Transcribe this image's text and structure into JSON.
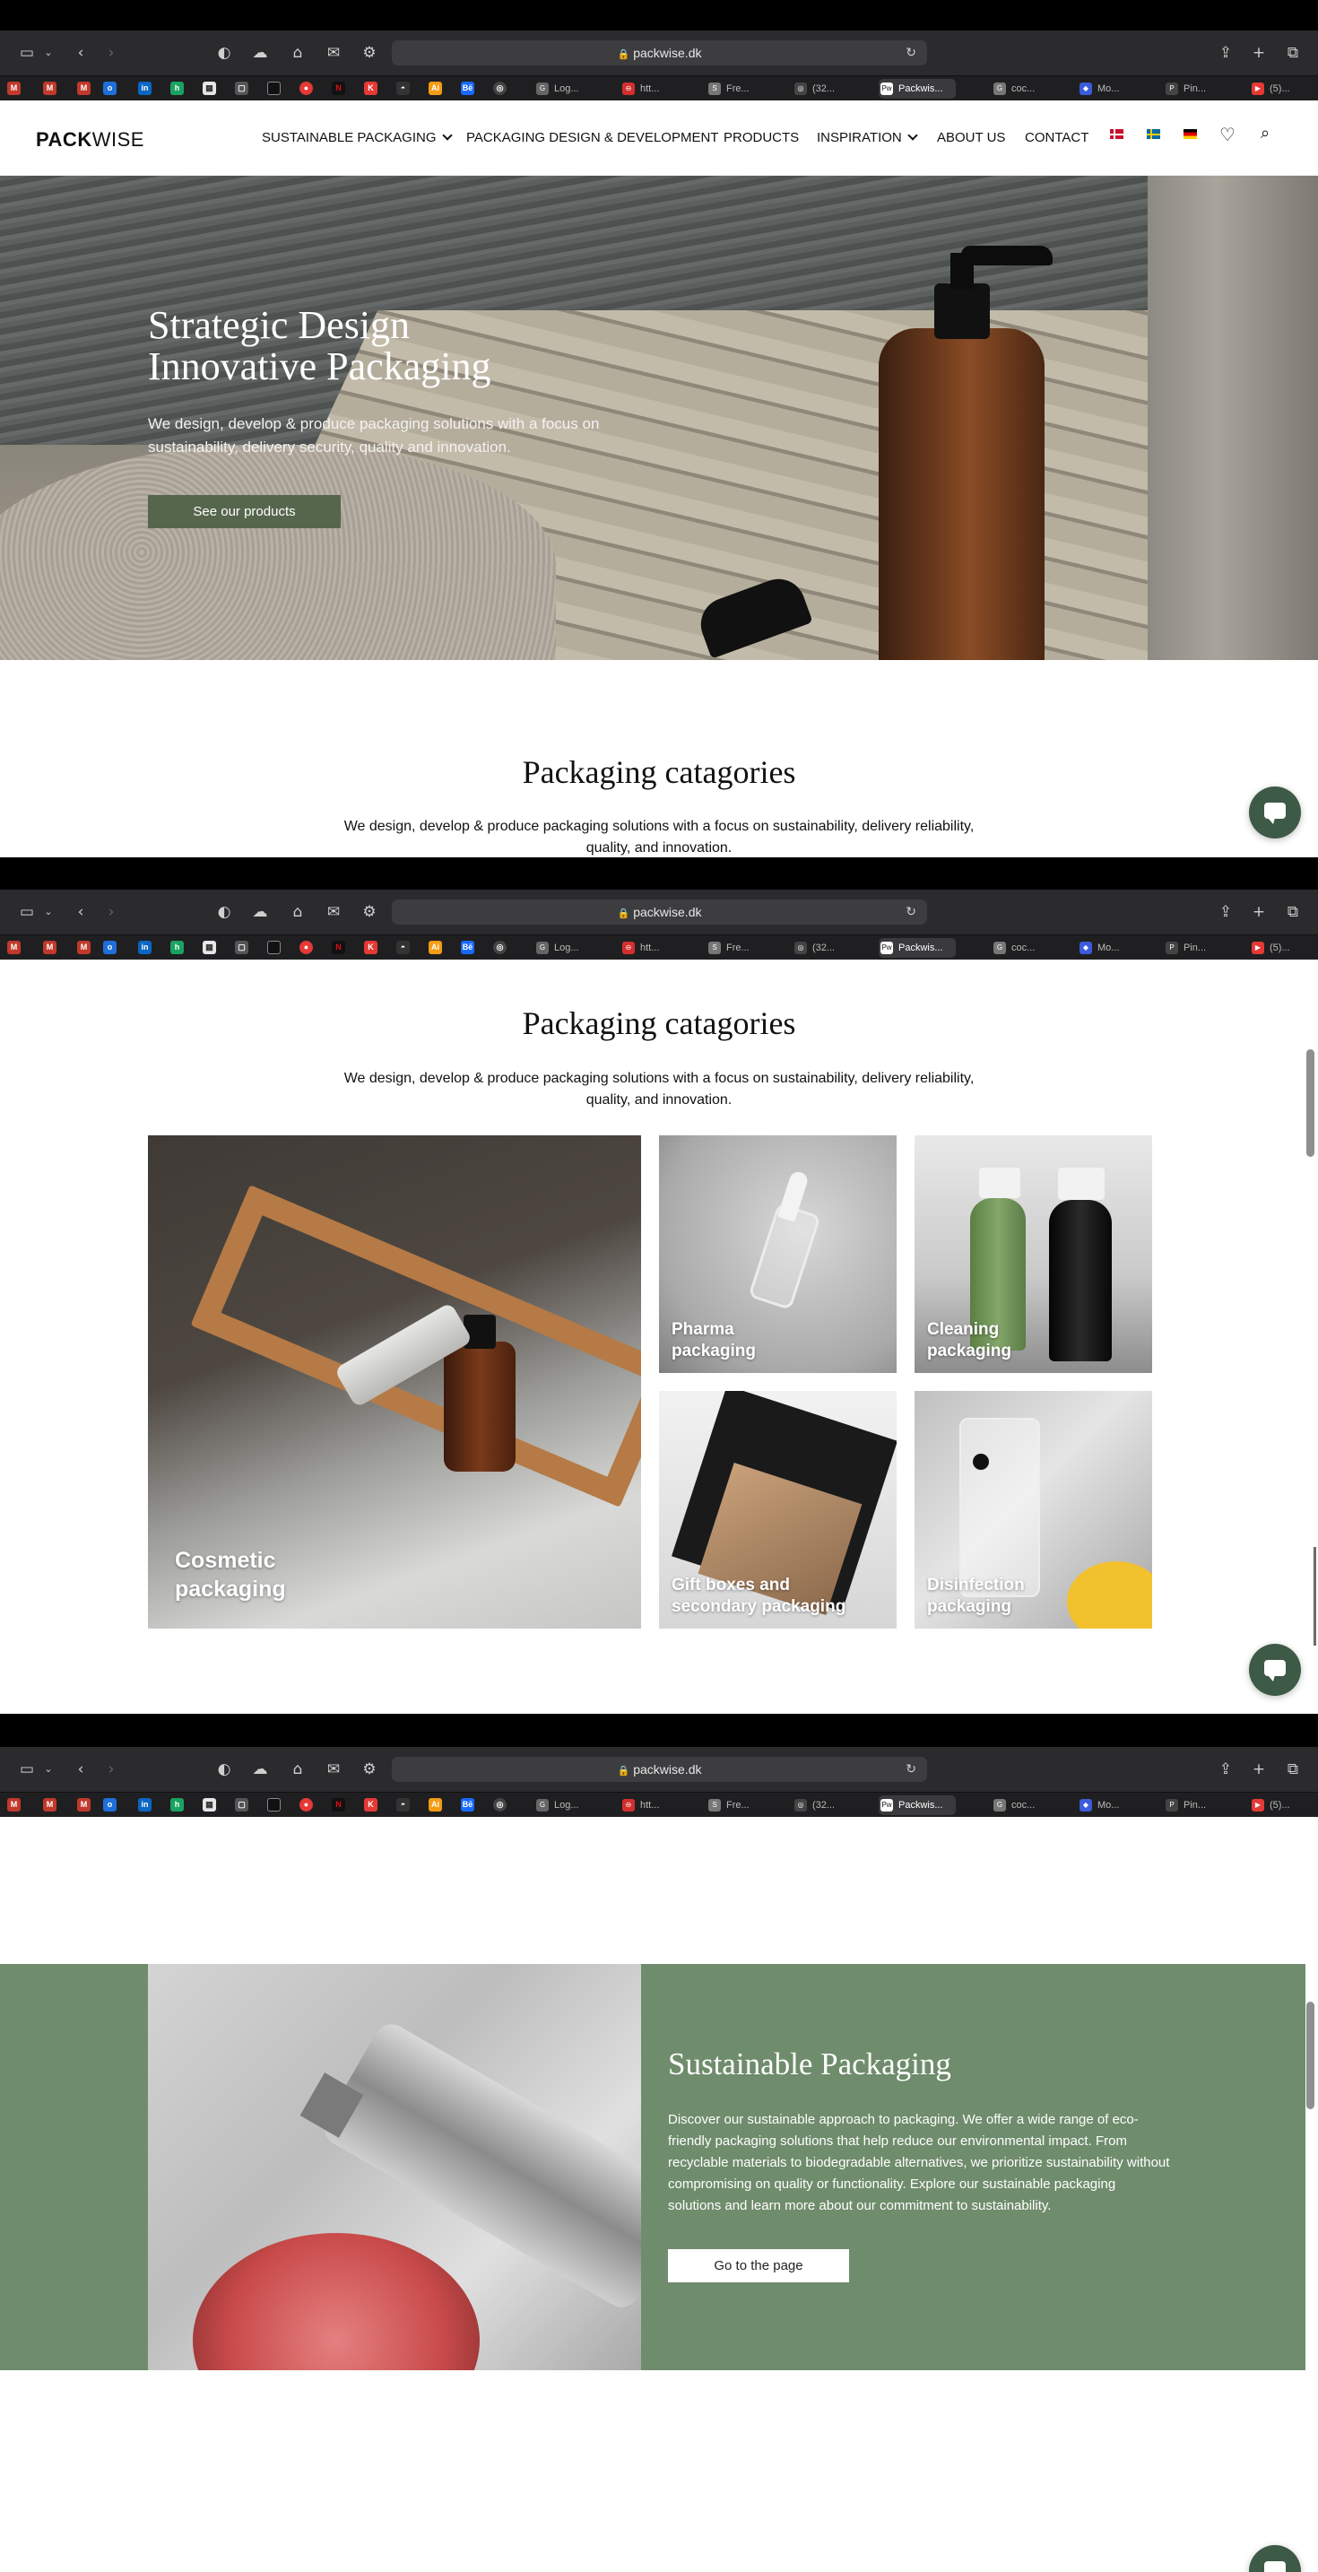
{
  "browser": {
    "url": "packwise.dk",
    "tabs": [
      {
        "label": "Log..."
      },
      {
        "label": "htt..."
      },
      {
        "label": "Fre..."
      },
      {
        "label": "(32..."
      },
      {
        "label": "Packwis..."
      },
      {
        "label": "coc..."
      },
      {
        "label": "Mo..."
      },
      {
        "label": "Pin..."
      },
      {
        "label": "(5)..."
      }
    ]
  },
  "nav": {
    "logo_bold": "PACK",
    "logo_light": "WISE",
    "items": [
      {
        "label": "SUSTAINABLE PACKAGING"
      },
      {
        "label": "PACKAGING DESIGN & DEVELOPMENT"
      },
      {
        "label": "PRODUCTS"
      },
      {
        "label": "INSPIRATION"
      },
      {
        "label": "ABOUT US"
      },
      {
        "label": "CONTACT"
      }
    ]
  },
  "hero": {
    "title_line1": "Strategic Design",
    "title_line2": "Innovative Packaging",
    "subtitle": "We design, develop & produce packaging solutions with a focus on sustainability, delivery security, quality and innovation.",
    "button": "See our products"
  },
  "categories": {
    "title": "Packaging catagories",
    "subtitle": "We design, develop & produce packaging solutions with a focus on sustainability, delivery reliability, quality, and innovation.",
    "tiles": [
      {
        "line1": "Cosmetic",
        "line2": "packaging"
      },
      {
        "line1": "Pharma",
        "line2": "packaging"
      },
      {
        "line1": "Cleaning",
        "line2": "packaging"
      },
      {
        "line1": "Gift boxes and",
        "line2": "secondary packaging"
      },
      {
        "line1": "Disinfection",
        "line2": "packaging"
      }
    ]
  },
  "sustainable": {
    "title": "Sustainable Packaging",
    "text": "Discover our sustainable approach to packaging. We offer a wide range of eco-friendly packaging solutions that help reduce our environmental impact. From recyclable materials to biodegradable alternatives, we prioritize sustainability without compromising on quality or functionality. Explore our sustainable packaging solutions and learn more about our commitment to sustainability.",
    "button": "Go to the page"
  },
  "colors": {
    "brand_green": "#55664d",
    "sustainable_bg": "#6f8c6c",
    "chat_button": "#3d5a46"
  }
}
